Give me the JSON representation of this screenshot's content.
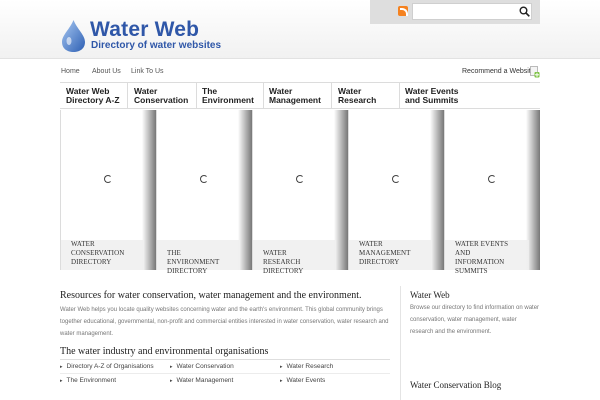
{
  "header": {
    "site_title": "Water Web",
    "tagline": "Directory of water websites",
    "search": {
      "placeholder": "",
      "value": ""
    }
  },
  "topnav": {
    "links": [
      "Home",
      "About Us",
      "Link To Us"
    ],
    "recommend": "Recommend a Website"
  },
  "menu": {
    "items": [
      [
        "Water Web",
        "Directory A-Z"
      ],
      [
        "Water",
        "Conservation"
      ],
      [
        "The",
        "Environment"
      ],
      [
        "Water",
        "Management"
      ],
      [
        "Water",
        "Research"
      ],
      [
        "Water Events",
        "and Summits"
      ]
    ]
  },
  "slides": [
    [
      "WATER",
      "CONSERVATION",
      "DIRECTORY"
    ],
    [
      "THE ENVIRONMENT",
      "DIRECTORY"
    ],
    [
      "WATER RESEARCH",
      "DIRECTORY"
    ],
    [
      "WATER",
      "MANAGEMENT",
      "DIRECTORY"
    ],
    [
      "WATER EVENTS AND",
      "INFORMATION",
      "SUMMITS"
    ]
  ],
  "main": {
    "intro_title": "Resources for water conservation, water management and the environment.",
    "intro_text": "Water Web helps you locate quality websites concerning water and the earth's environment. This global community brings together educational, governmental, non-profit and commercial entities interested in water conservation, water research and water management.",
    "org_title": "The water industry and environmental organisations",
    "org_links": [
      "Directory A-Z of Organisations",
      "Water Conservation",
      "Water Research",
      "The Environment",
      "Water Management",
      "Water Events"
    ]
  },
  "sidebar": {
    "title": "Water Web",
    "text": "Browse our directory to find information on water conservation, water management, water research and the environment.",
    "title2": "Water Conservation Blog"
  },
  "colors": {
    "brand": "#2f57a8",
    "rss": "#f58220",
    "plus": "#7cc242"
  }
}
